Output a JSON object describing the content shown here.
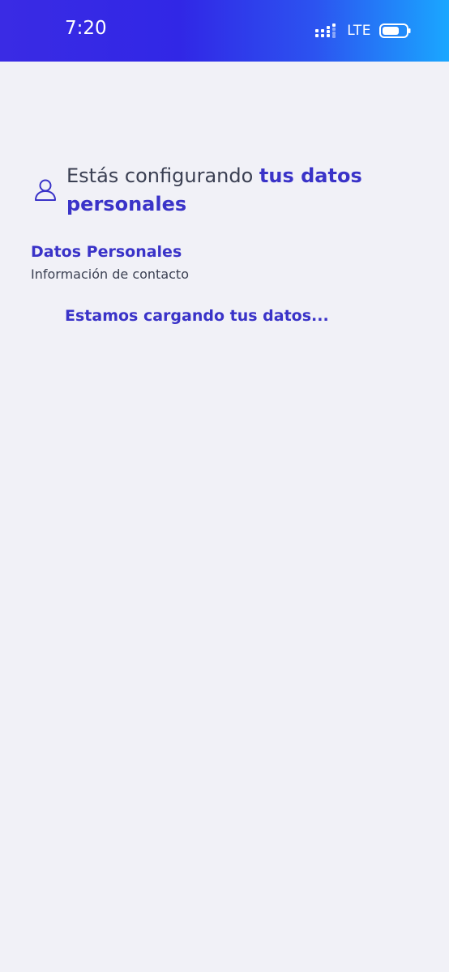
{
  "status_bar": {
    "time": "7:20",
    "network": "LTE",
    "signal_icon": "signal-icon",
    "battery_icon": "battery-icon"
  },
  "header": {
    "icon": "user-icon",
    "prefix": "Estás configurando ",
    "emphasis": "tus datos personales"
  },
  "section": {
    "title": "Datos Personales",
    "subtitle": "Información de contacto"
  },
  "loading": {
    "message": "Estamos cargando tus datos..."
  },
  "colors": {
    "accent": "#3a33c8",
    "background": "#f1f1f7",
    "text": "#3a3f52"
  }
}
